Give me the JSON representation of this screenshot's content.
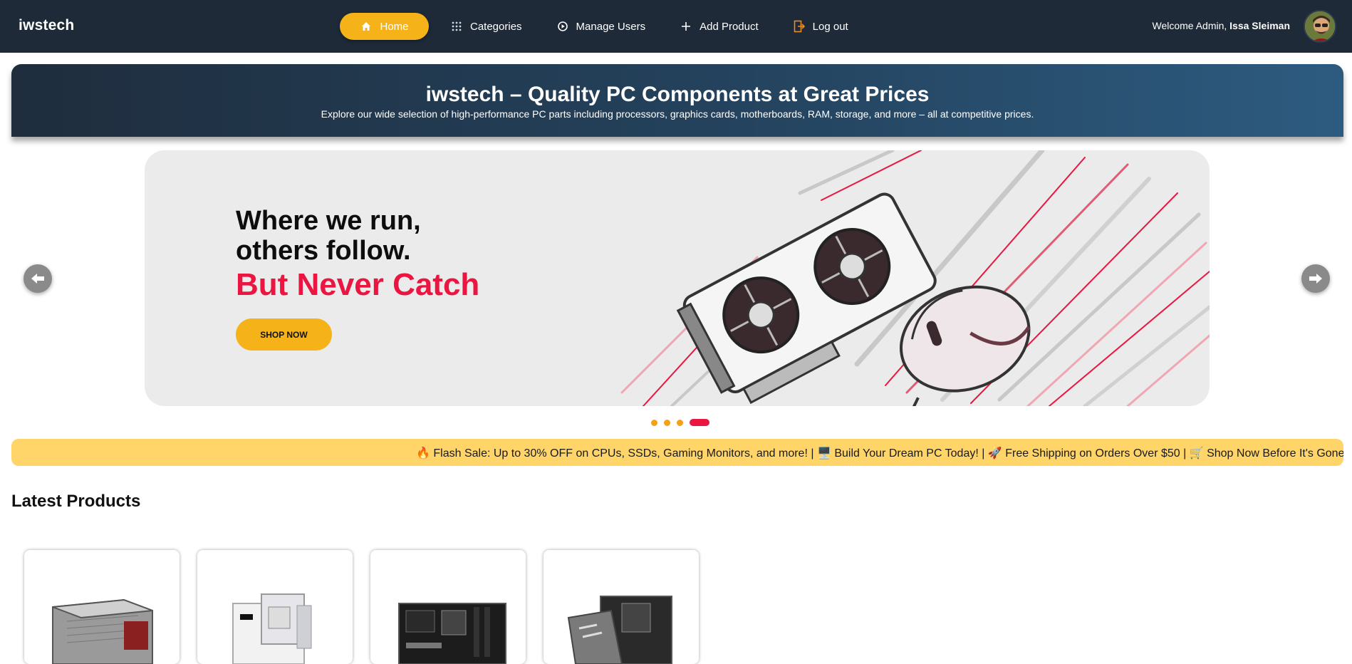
{
  "navbar": {
    "brand": "iwstech",
    "items": [
      {
        "label": "Home",
        "icon": "home-icon",
        "active": true
      },
      {
        "label": "Categories",
        "icon": "grid-icon",
        "active": false
      },
      {
        "label": "Manage Users",
        "icon": "users-icon",
        "active": false
      },
      {
        "label": "Add Product",
        "icon": "plus-icon",
        "active": false
      },
      {
        "label": "Log out",
        "icon": "logout-icon",
        "active": false
      }
    ],
    "welcome_prefix": "Welcome Admin,",
    "user_name": "Issa Sleiman"
  },
  "hero": {
    "title": "iwstech – Quality PC Components at Great Prices",
    "subtitle": "Explore our wide selection of high-performance PC parts including processors, graphics cards, motherboards, RAM, storage, and more – all at competitive prices."
  },
  "carousel": {
    "line1": "Where we run,",
    "line2": "others follow.",
    "line3": "But Never Catch",
    "button": "SHOP NOW",
    "slide_count": 4,
    "active_slide": 4
  },
  "ticker": {
    "text": "🔥 Flash Sale: Up to 30% OFF on CPUs, SSDs, Gaming Monitors, and more! | 🖥️ Build Your Dream PC Today! | 🚀 Free Shipping on Orders Over $50 | 🛒 Shop Now Before It's Gone!"
  },
  "products": {
    "title": "Latest Products",
    "items": [
      {
        "kind": "power-supply"
      },
      {
        "kind": "motherboard-white"
      },
      {
        "kind": "motherboard-black"
      },
      {
        "kind": "motherboard-box"
      }
    ]
  },
  "colors": {
    "navbar": "#1e2a38",
    "accent": "#f5b319",
    "highlight": "#ea1540",
    "ticker": "#ffd569"
  }
}
